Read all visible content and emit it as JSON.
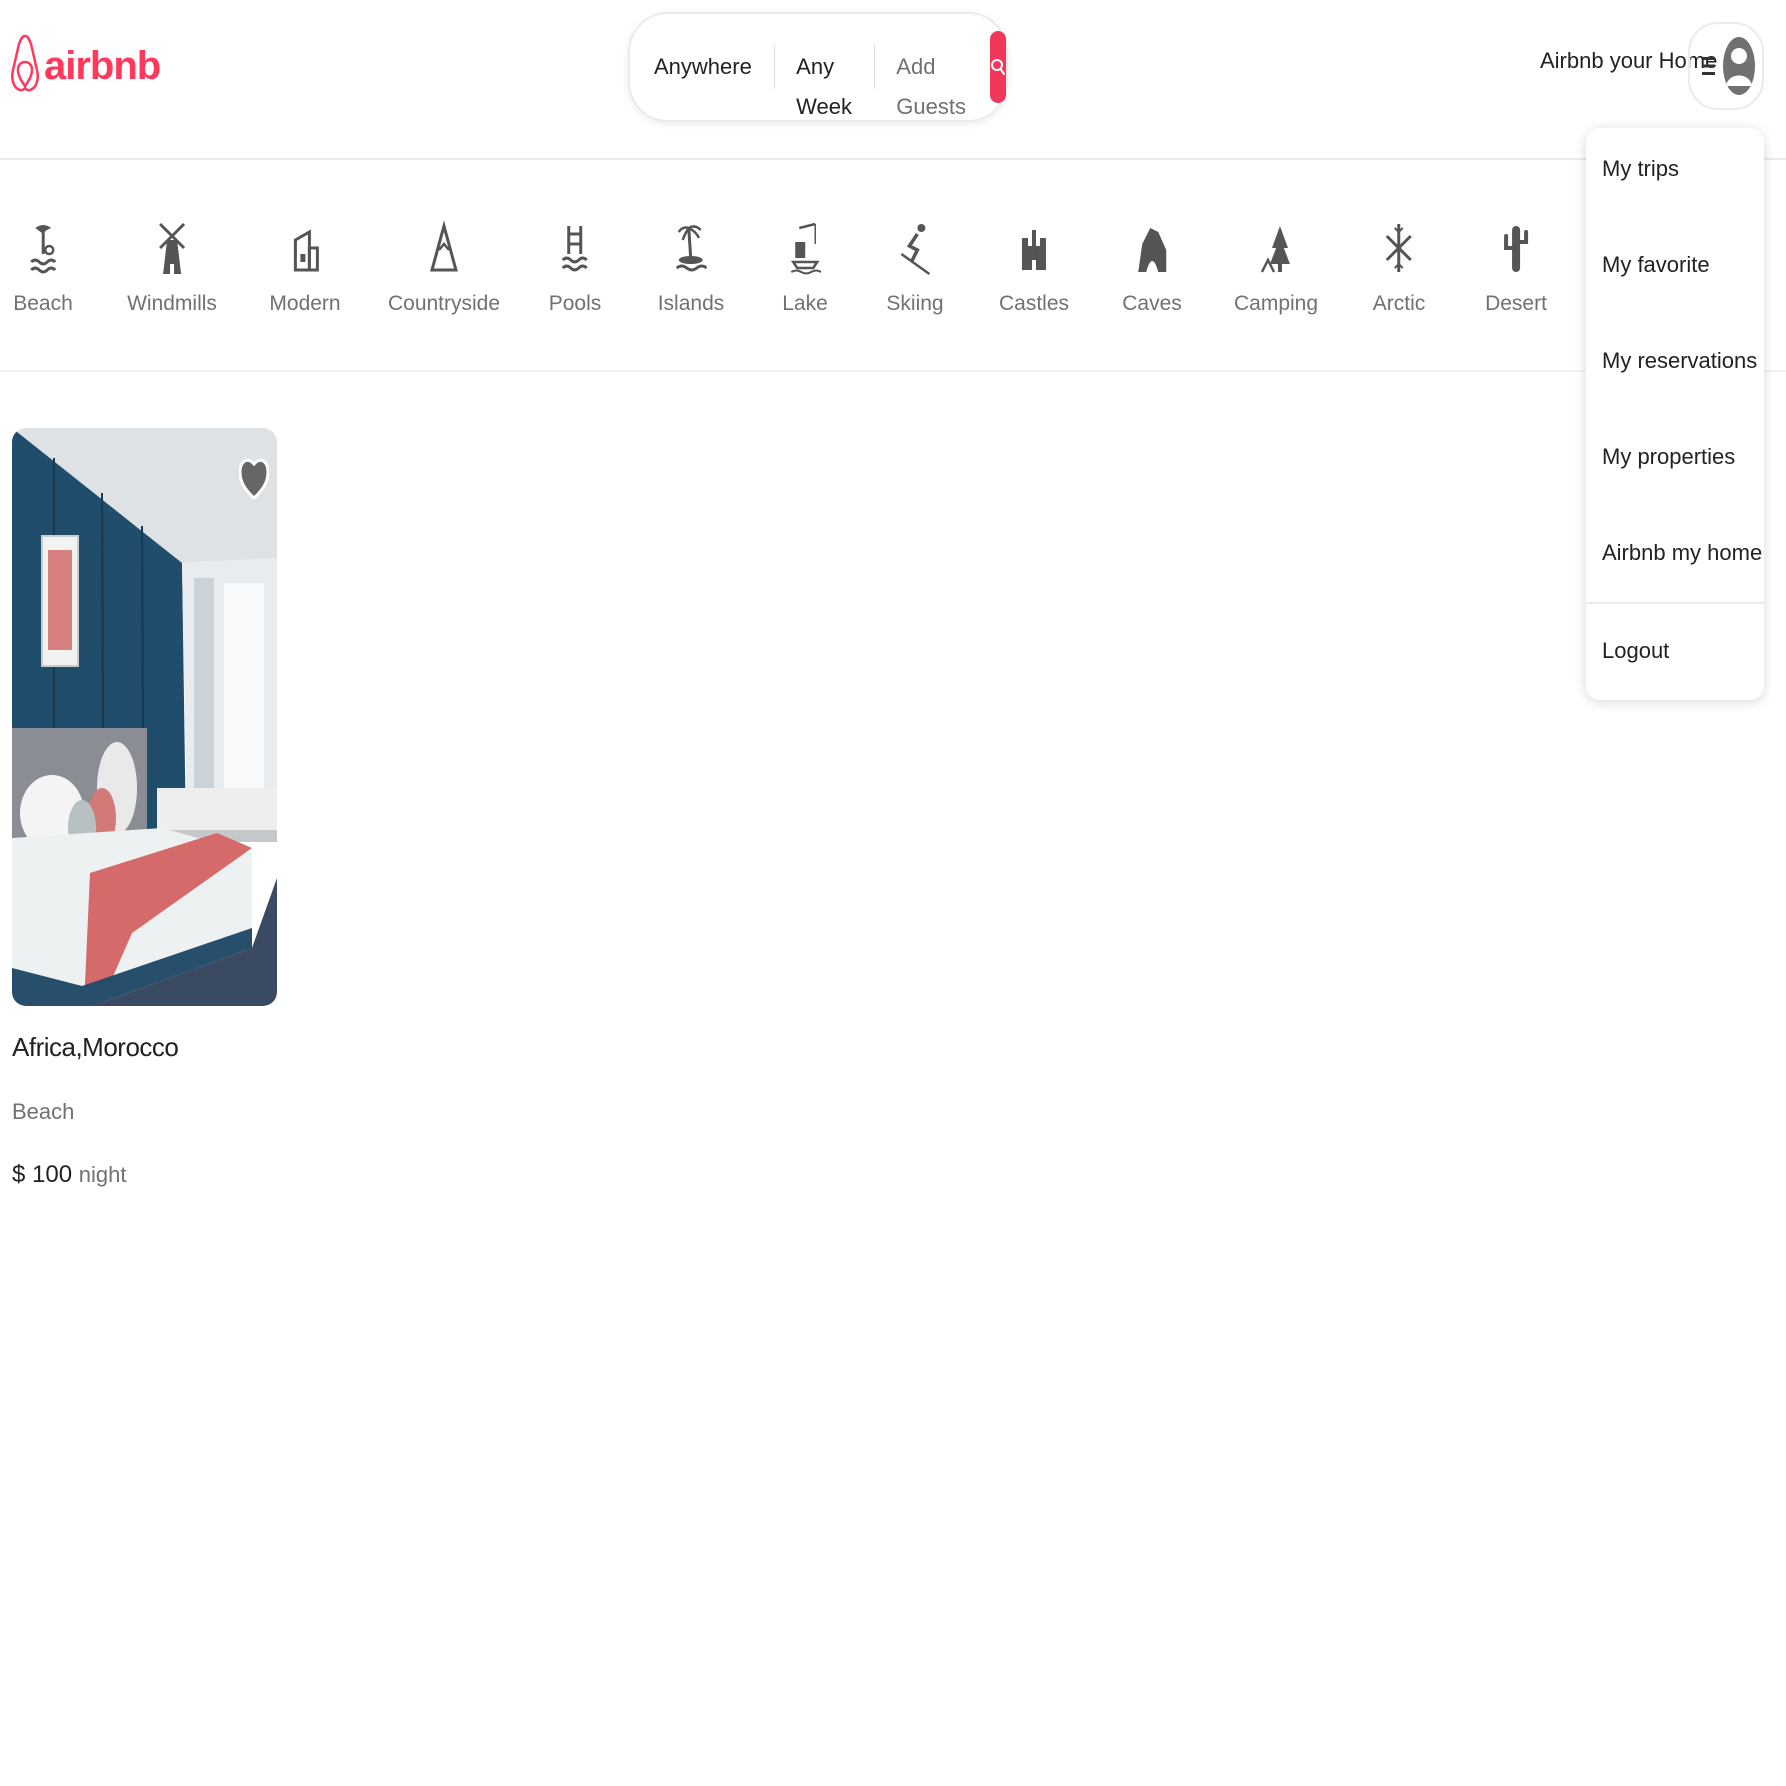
{
  "header": {
    "logo_text": "airbnb",
    "brand_color": "#ff385c",
    "host_link": "Airbnb your Home"
  },
  "search": {
    "where": "Anywhere",
    "when": "Any Week",
    "guests": "Add Guests",
    "button_icon": "search-icon"
  },
  "categories": [
    {
      "label": "Beach",
      "icon": "beach-icon"
    },
    {
      "label": "Windmills",
      "icon": "windmill-icon"
    },
    {
      "label": "Modern",
      "icon": "modern-house-icon"
    },
    {
      "label": "Countryside",
      "icon": "mountain-icon"
    },
    {
      "label": "Pools",
      "icon": "pool-icon"
    },
    {
      "label": "Islands",
      "icon": "island-icon"
    },
    {
      "label": "Lake",
      "icon": "lake-icon"
    },
    {
      "label": "Skiing",
      "icon": "skiing-icon"
    },
    {
      "label": "Castles",
      "icon": "castle-icon"
    },
    {
      "label": "Caves",
      "icon": "cave-icon"
    },
    {
      "label": "Camping",
      "icon": "camping-icon"
    },
    {
      "label": "Arctic",
      "icon": "snowflake-icon"
    },
    {
      "label": "Desert",
      "icon": "cactus-icon"
    }
  ],
  "listing": {
    "location": "Africa,Morocco",
    "category": "Beach",
    "price": "$ 100",
    "price_unit": "night",
    "favorite_icon": "heart-icon"
  },
  "user_menu": {
    "items": [
      "My trips",
      "My favorite",
      "My reservations",
      "My properties",
      "Airbnb my home"
    ],
    "logout": "Logout"
  }
}
